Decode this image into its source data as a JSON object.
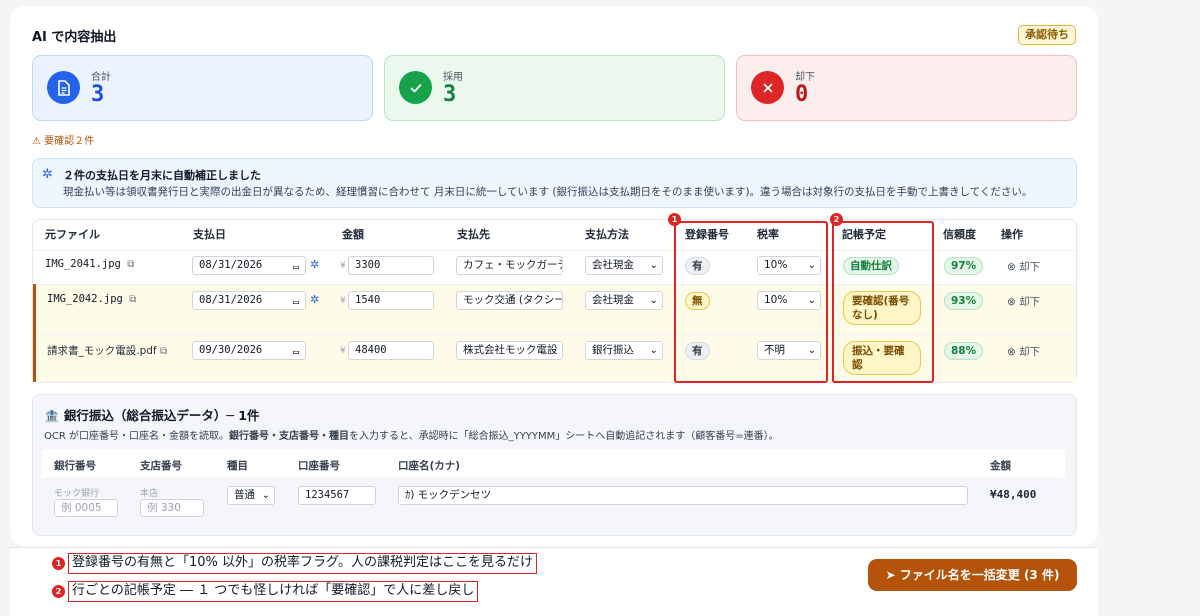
{
  "header": {
    "title": "AI で内容抽出",
    "status": "承認待ち"
  },
  "stats": [
    {
      "label": "合計",
      "value": "3"
    },
    {
      "label": "採用",
      "value": "3"
    },
    {
      "label": "却下",
      "value": "0"
    }
  ],
  "warning": "要確認２件",
  "info": {
    "heading": "２件の支払日を月末に自動補正しました",
    "body": "現金払い等は領収書発行日と実際の出金日が異なるため、経理慣習に合わせて 月末日に統一しています (銀行振込は支払期日をそのまま使います)。違う場合は対象行の支払日を手動で上書きしてください。"
  },
  "table": {
    "headers": [
      "元ファイル",
      "支払日",
      "金額",
      "支払先",
      "支払方法",
      "登録番号",
      "税率",
      "記帳予定",
      "信頼度",
      "操作"
    ],
    "rows": [
      {
        "file": "IMG_2041.jpg",
        "date": "08/31/2026",
        "amount": "3300",
        "payee": "カフェ・モックガーデン",
        "method": "会社現金",
        "reg": "有",
        "tax": "10%",
        "plan": "自動仕訳",
        "confidence": "97%",
        "action": "却下"
      },
      {
        "file": "IMG_2042.jpg",
        "date": "08/31/2026",
        "amount": "1540",
        "payee": "モック交通 (タクシー)",
        "method": "会社現金",
        "reg": "無",
        "tax": "10%",
        "plan": "要確認(番号なし)",
        "confidence": "93%",
        "action": "却下"
      },
      {
        "file": "請求書_モック電設.pdf",
        "date": "09/30/2026",
        "amount": "48400",
        "payee": "株式会社モック電設",
        "method": "銀行振込",
        "reg": "有",
        "tax": "不明",
        "plan": "振込・要確認",
        "confidence": "88%",
        "action": "却下"
      }
    ],
    "currency_symbol": "¥",
    "markers": [
      "1",
      "2"
    ]
  },
  "bank": {
    "title": "銀行振込（総合振込データ）─ 1件",
    "desc_pre": "OCR が口座番号・口座名・金額を読取。",
    "desc_bold": "銀行番号・支店番号・種目",
    "desc_post": "を入力すると、承認時に「総合振込_YYYYMM」シートへ自動追記されます（顧客番号=連番）。",
    "headers": [
      "銀行番号",
      "支店番号",
      "種目",
      "口座番号",
      "口座名(カナ)",
      "金額"
    ],
    "bank_hint": "モック銀行",
    "bank_placeholder": "例 0005",
    "branch_hint": "本店",
    "branch_placeholder": "例 330",
    "type": "普通",
    "account": "1234567",
    "account_name": "ｶ) モックデンセツ",
    "amount": "¥48,400"
  },
  "notes": [
    {
      "num": "1",
      "text": "登録番号の有無と「10% 以外」の税率フラグ。人の課税判定はここを見るだけ"
    },
    {
      "num": "2",
      "text": "行ごとの記帳予定 ― １ つでも怪しければ「要確認」で人に差し戻し"
    }
  ],
  "action_button": "ファイル名を一括変更 (3 件)",
  "colors": {
    "accent": "#b45309",
    "total": "#2563eb",
    "accept": "#16a34a",
    "reject": "#dc2626",
    "highlight": "#dc2626"
  }
}
